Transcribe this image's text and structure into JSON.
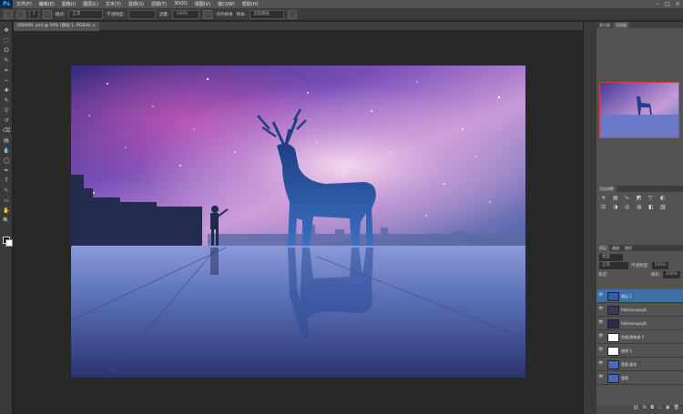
{
  "app": {
    "logo": "Ps"
  },
  "menu": [
    "文件(F)",
    "编辑(E)",
    "图像(I)",
    "图层(L)",
    "文字(Y)",
    "选择(S)",
    "滤镜(T)",
    "3D(D)",
    "视图(V)",
    "窗口(W)",
    "帮助(H)"
  ],
  "window_controls": [
    "–",
    "□",
    "×"
  ],
  "options": {
    "mode_label": "模式:",
    "mode_value": "正常",
    "opacity_label": "不透明度:",
    "flow_label": "流量:",
    "flow_value": "100%",
    "align_label": "对齐样本",
    "sample_label": "样本:",
    "sample_value": "当前图层",
    "size_value": "5"
  },
  "document": {
    "tab_title": "000000 .psd @ 50% (图层 1, RGB/8) ×"
  },
  "tools": [
    "move-tool-icon",
    "marquee-tool-icon",
    "lasso-tool-icon",
    "quick-select-icon",
    "crop-tool-icon",
    "eyedropper-icon",
    "healing-brush-icon",
    "brush-tool-icon",
    "clone-stamp-icon",
    "history-brush-icon",
    "eraser-icon",
    "gradient-icon",
    "blur-icon",
    "dodge-icon",
    "pen-tool-icon",
    "type-tool-icon",
    "path-select-icon",
    "shape-tool-icon",
    "hand-tool-icon",
    "zoom-tool-icon"
  ],
  "navigator": {
    "tabs": [
      "直方图",
      "导航器"
    ]
  },
  "adjustments": {
    "title": "添加调整"
  },
  "layers_panel": {
    "tabs": [
      "图层",
      "通道",
      "路径"
    ],
    "kind_label": "类型",
    "blend_mode": "正常",
    "opacity_label": "不透明度:",
    "opacity_value": "100%",
    "lock_label": "锁定:",
    "fill_label": "填充:",
    "fill_value": "100%",
    "layers": [
      {
        "name": "图层 1",
        "selected": true
      },
      {
        "name": "hahnsangngit...",
        "selected": false
      },
      {
        "name": "hahnsangngit...",
        "selected": false
      },
      {
        "name": "色相/饱和度 1",
        "selected": false
      },
      {
        "name": "曲线 1",
        "selected": false
      },
      {
        "name": "背景 副本",
        "selected": false
      },
      {
        "name": "背景",
        "selected": false
      }
    ]
  },
  "colors": {
    "accent": "#3d6fa8",
    "panel": "#535353",
    "canvas_bg": "#282828"
  }
}
